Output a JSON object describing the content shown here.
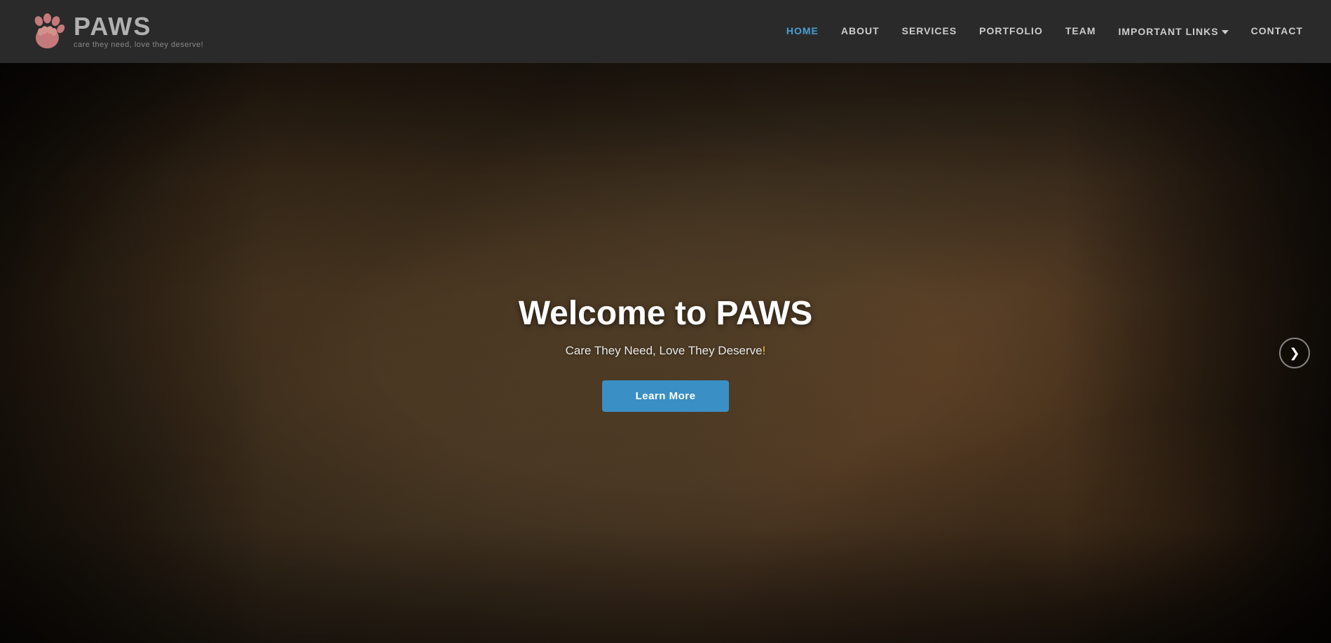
{
  "navbar": {
    "logo": {
      "title": "PAWS",
      "tagline": "care they need, love they deserve!"
    },
    "nav_items": [
      {
        "label": "HOME",
        "active": true,
        "id": "home"
      },
      {
        "label": "ABOUT",
        "active": false,
        "id": "about"
      },
      {
        "label": "SERVICES",
        "active": false,
        "id": "services"
      },
      {
        "label": "PORTFOLIO",
        "active": false,
        "id": "portfolio"
      },
      {
        "label": "TEAM",
        "active": false,
        "id": "team"
      },
      {
        "label": "IMPORTANT LINKS",
        "active": false,
        "id": "important-links",
        "dropdown": true
      },
      {
        "label": "CONTACT",
        "active": false,
        "id": "contact"
      }
    ]
  },
  "hero": {
    "title": "Welcome to PAWS",
    "subtitle_regular": "Care They Need, Love They Deserve",
    "subtitle_emphasis": "!",
    "cta_label": "Learn More"
  },
  "carousel": {
    "next_arrow": "❯"
  },
  "colors": {
    "nav_bg": "#2a2a2a",
    "active_link": "#4a9fd4",
    "cta_bg": "#3a8fc4",
    "hero_text": "#ffffff"
  }
}
